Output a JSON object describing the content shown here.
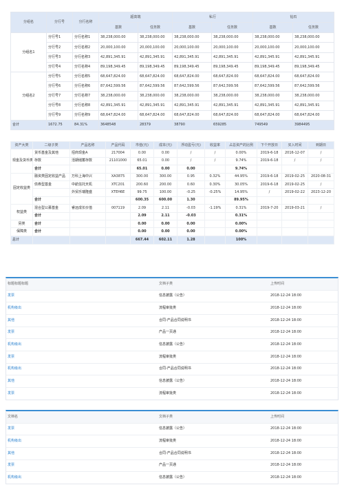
{
  "branch_table": {
    "head": {
      "group_name": "分组名",
      "branch_no": "分行号",
      "branch_name": "分行名称",
      "group_a": "超高端",
      "group_b": "私行",
      "group_c": "钻石",
      "base": "基数",
      "target": "任务数"
    },
    "groups": [
      {
        "name": "分组名1",
        "rows": [
          [
            "分行号1",
            "分行名称1",
            "38,238,000.00",
            "38,238,000.00",
            "38,238,000.00",
            "38,238,000.00",
            "38,238,000.00",
            "38,238,000.00"
          ],
          [
            "分行号2",
            "分行名称2",
            "20,000,100.00",
            "20,000,100.00",
            "20,000,100.00",
            "20,000,100.00",
            "20,000,100.00",
            "20,000,100.00"
          ],
          [
            "分行号3",
            "分行名称3",
            "42,891,345.91",
            "42,891,345.91",
            "42,891,345.91",
            "42,891,345.91",
            "42,891,345.91",
            "42,891,345.91"
          ],
          [
            "分行号4",
            "分行名称4",
            "89,198,349.45",
            "89,198,349.45",
            "89,198,349.45",
            "89,198,349.45",
            "89,198,349.45",
            "89,198,349.45"
          ]
        ]
      },
      {
        "name": "分组名2",
        "rows": [
          [
            "分行号5",
            "分行名称5",
            "68,647,824.00",
            "68,647,824.00",
            "68,647,824.00",
            "68,647,824.00",
            "68,647,824.00",
            "68,647,824.00"
          ],
          [
            "分行号6",
            "分行名称6",
            "87,642,599.56",
            "87,642,599.56",
            "87,642,599.56",
            "87,642,599.56",
            "87,642,599.56",
            "87,642,599.56"
          ],
          [
            "分行号7",
            "分行名称7",
            "38,238,000.00",
            "38,238,000.00",
            "38,238,000.00",
            "38,238,000.00",
            "38,238,000.00",
            "38,238,000.00"
          ],
          [
            "分行号8",
            "分行名称8",
            "42,891,345.91",
            "42,891,345.91",
            "42,891,345.91",
            "42,891,345.91",
            "42,891,345.91",
            "42,891,345.91"
          ],
          [
            "分行号9",
            "分行名称9",
            "68,647,824.00",
            "68,647,824.00",
            "68,647,824.00",
            "68,647,824.00",
            "68,647,824.00",
            "68,647,824.00"
          ]
        ]
      }
    ],
    "total": [
      "合计",
      "1672.75",
      "84.31%",
      "3648548",
      "28379",
      "38790",
      "659285",
      "749549",
      "3984495"
    ]
  },
  "asset_table": {
    "head": [
      "资产大类",
      "二级子类",
      "产品名称",
      "产品代码",
      "市值(元)",
      "成本(元)",
      "浮动盈亏(元)",
      "收益率",
      "占总资产的比例",
      "下个开放日",
      "买入时间",
      "到期日"
    ],
    "rows": [
      [
        "现金及货币类",
        "货币基金及其他",
        "招商现金A",
        "217004",
        "0.00",
        "0.00",
        "/",
        "/",
        "0.00%",
        "2019-6-18",
        "2016-12-07",
        "/"
      ],
      [
        "",
        "存款",
        "活期储蓄存款",
        "21101000",
        "65.01",
        "0.00",
        "/",
        "/",
        "9.74%",
        "2019-6-18",
        "/",
        "/"
      ],
      [
        "",
        "合计",
        "",
        "",
        "65.01",
        "0.00",
        "0.00",
        "",
        "9.74%",
        "",
        "",
        ""
      ],
      [
        "固定收益类",
        "融资类固定收益产品",
        "万科上海中兴",
        "XA3875",
        "300.00",
        "300.00",
        "0.95",
        "0.32%",
        "44.95%",
        "2019-6-18",
        "2019-02-25",
        "2020-08-31"
      ],
      [
        "",
        "债券型基金",
        "中航信托天机",
        "XTC201",
        "200.60",
        "200.00",
        "0.60",
        "0.30%",
        "30.05%",
        "2019-6-18",
        "2019-02-25",
        "/"
      ],
      [
        "",
        "",
        "外贸乐瑞隆盛",
        "XTEH6E",
        "99.75",
        "100.00",
        "-0.25",
        "-0.25%",
        "14.95%",
        "/",
        "2019-02-22",
        "2023-12-20"
      ],
      [
        "",
        "合计",
        "",
        "",
        "600.35",
        "600.00",
        "1.30",
        "",
        "89.95%",
        "",
        "",
        ""
      ],
      [
        "权益类",
        "混合型公募基金",
        "睿远成长价值",
        "007119",
        "2.09",
        "2.11",
        "-0.03",
        "-1.19%",
        "0.31%",
        "2019-7-20",
        "2019-03-21",
        "/"
      ],
      [
        "",
        "合计",
        "",
        "",
        "2.09",
        "2.11",
        "-0.03",
        "",
        "0.31%",
        "",
        "",
        ""
      ],
      [
        "另类",
        "合计",
        "",
        "",
        "0.00",
        "0.00",
        "0.00",
        "",
        "0.00%",
        "",
        "",
        ""
      ],
      [
        "保障类",
        "合计",
        "",
        "",
        "0.00",
        "0.00",
        "0.00",
        "",
        "0.00%",
        "",
        "",
        ""
      ]
    ],
    "total": [
      "总计",
      "",
      "",
      "",
      "667.44",
      "602.11",
      "1.28",
      "",
      "100%",
      "",
      "",
      ""
    ]
  },
  "doc_table_1": {
    "head": [
      "标题标题标题",
      "文档子类",
      "上传时间"
    ],
    "rows": [
      [
        "发票",
        "信息披露（公告）",
        "2018-12-24  18:00"
      ],
      [
        "机构级出",
        "流程审批类",
        "2018-12-24  18:00"
      ],
      [
        "其他",
        "合同-产品合同说明书",
        "2018-12-24  18:00"
      ],
      [
        "发票",
        "产品一页通",
        "2018-12-24  18:00"
      ],
      [
        "机构级出",
        "信息披露（公告）",
        "2018-12-24  18:00"
      ],
      [
        "发票",
        "流程审批类",
        "2018-12-24  18:00"
      ],
      [
        "机构级出",
        "合同-产品合同说明书",
        "2018-12-24  18:00"
      ],
      [
        "其他",
        "信息披露（公告）",
        "2018-12-24  18:00"
      ],
      [
        "发票",
        "流程审批类",
        "2018-12-24  18:00"
      ]
    ]
  },
  "doc_table_2": {
    "head": [
      "文档名",
      "文档子类",
      "上传时间"
    ],
    "rows": [
      [
        "发票",
        "信息披露（公告）",
        "2018-12-24  18:00"
      ],
      [
        "机构级出",
        "流程审批类",
        "2018-12-24  18:00"
      ],
      [
        "其他",
        "合同-产品合同说明书",
        "2018-12-24  18:00"
      ],
      [
        "发票",
        "产品一页通",
        "2018-12-24  18:00"
      ],
      [
        "机构级出",
        "信息披露（公告）",
        "2018-12-24  18:00"
      ]
    ]
  },
  "colors": {
    "header_bg": "#dde7f6",
    "link": "#2d83d0",
    "accent_border": "#3a8ed3"
  }
}
